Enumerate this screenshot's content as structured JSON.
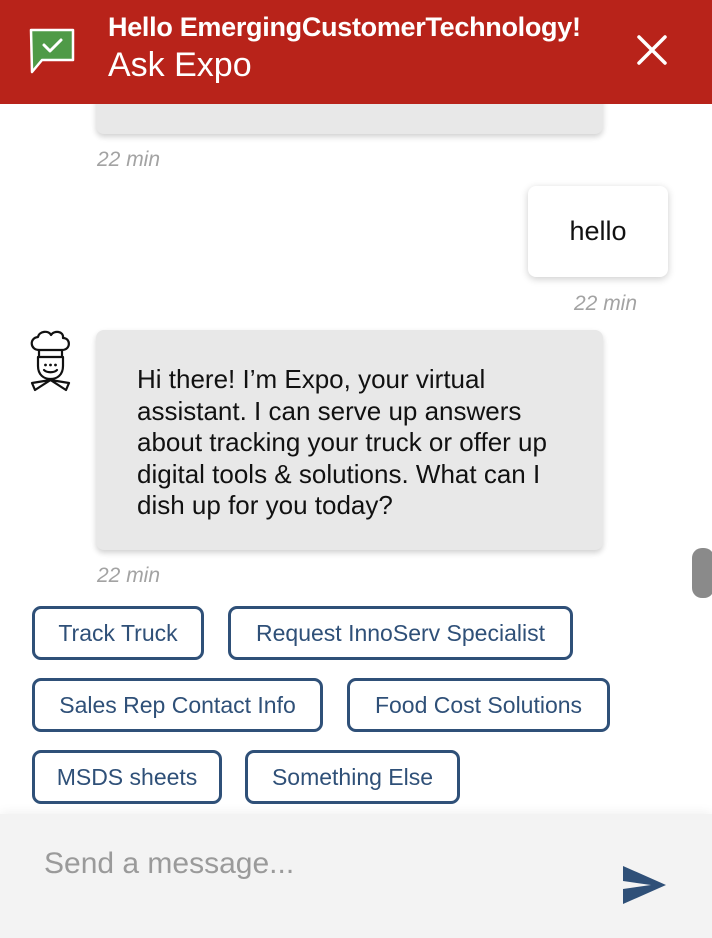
{
  "header": {
    "greeting": "Hello EmergingCustomerTechnology!",
    "title": "Ask Expo",
    "chat_icon": "chat-check-icon",
    "close_icon": "close-icon",
    "background_color": "#b8231a"
  },
  "messages": {
    "previous_time": "22 min",
    "user_message": {
      "text": "hello",
      "time": "22 min"
    },
    "bot_message": {
      "text": "Hi there! I’m Expo, your virtual assistant. I can serve up answers about tracking your truck or offer up digital tools & solutions. What can I dish up for you today?",
      "time": "22 min",
      "avatar_icon": "chef-avatar-icon"
    }
  },
  "quick_replies": [
    "Track Truck",
    "Request InnoServ Specialist",
    "Sales Rep Contact Info",
    "Food Cost Solutions",
    "MSDS sheets",
    "Something Else"
  ],
  "composer": {
    "placeholder": "Send a message...",
    "send_icon": "send-icon"
  },
  "colors": {
    "button_border": "#2f5078",
    "bot_bubble": "#e8e8e8",
    "timestamp": "#a3a3a3"
  }
}
